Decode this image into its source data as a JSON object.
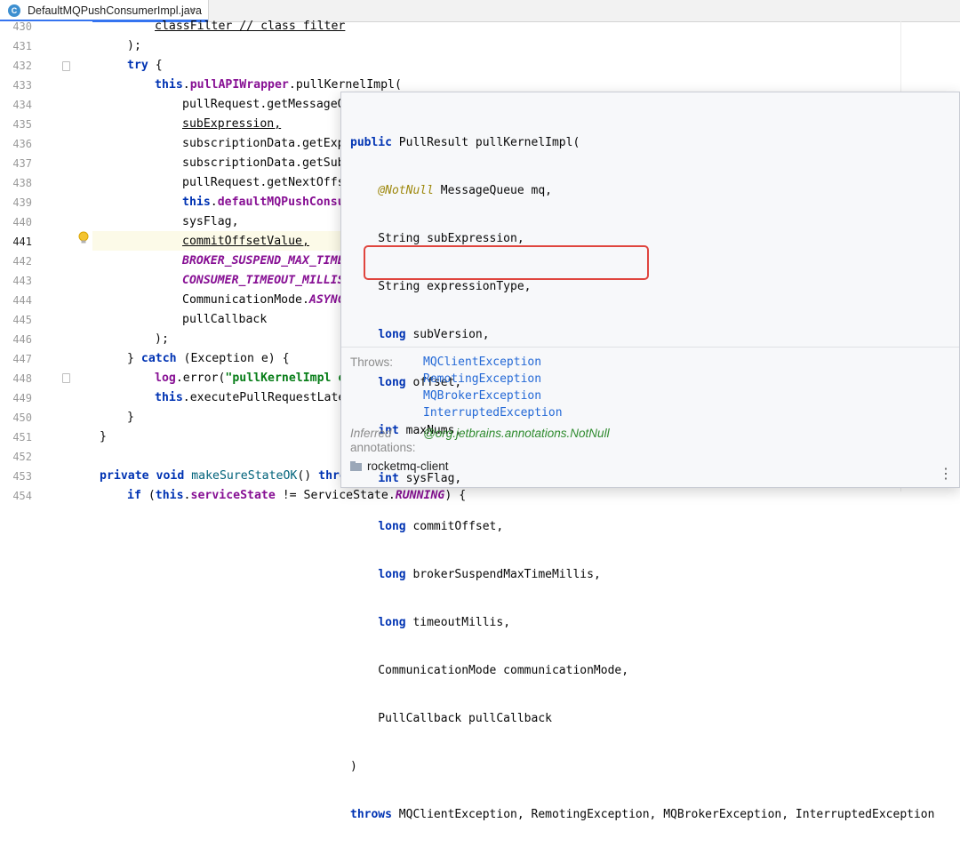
{
  "tab": {
    "label": "DefaultMQPushConsumerImpl.java",
    "icon_letter": "C",
    "icon": "class-icon",
    "close": "×"
  },
  "gutter": {
    "lines": [
      "430",
      "431",
      "432",
      "433",
      "434",
      "435",
      "436",
      "437",
      "438",
      "439",
      "440",
      "441",
      "442",
      "443",
      "444",
      "445",
      "446",
      "447",
      "448",
      "449",
      "450",
      "451",
      "452",
      "453",
      "454"
    ],
    "active_line": "441"
  },
  "code_lines": [
    "classFilter // class filter",
    ");",
    "try {",
    "this.pullAPIWrapper.pullKernelImpl(",
    "pullRequest.getMessageQ",
    "subExpression,",
    "subscriptionData.getExp",
    "subscriptionData.getSub",
    "pullRequest.getNextOffs",
    "this.defaultMQPushConsu",
    "sysFlag,",
    "commitOffsetValue,",
    "BROKER_SUSPEND_MAX_TIME",
    "CONSUMER_TIMEOUT_MILLIS",
    "CommunicationMode.ASYNC",
    "pullCallback",
    ");",
    "} catch (Exception e) {",
    "log.error(\"pullKernelImpl e",
    "this.executePullRequestLate",
    "}",
    "}",
    "",
    "private void makeSureStateOK() thro",
    "if (this.serviceState != ServiceState.RUNNING) {"
  ],
  "popup": {
    "signature": [
      "public PullResult pullKernelImpl(",
      "    @NotNull MessageQueue mq,",
      "    String subExpression,",
      "    String expressionType,",
      "    long subVersion,",
      "    long offset,",
      "    int maxNums,",
      "    int sysFlag,",
      "    long commitOffset,",
      "    long brokerSuspendMaxTimeMillis,",
      "    long timeoutMillis,",
      "    CommunicationMode communicationMode,",
      "    PullCallback pullCallback",
      ")",
      "throws MQClientException, RemotingException, MQBrokerException, InterruptedException"
    ],
    "throws_label": "Throws:",
    "throws": [
      "MQClientException",
      "RemotingException",
      "MQBrokerException",
      "InterruptedException"
    ],
    "inferred_label": "Inferred",
    "annotations_label": "annotations:",
    "inferred_value": "@org.jetbrains.annotations.NotNull",
    "module": "rocketmq-client",
    "more": "⋮"
  },
  "colors": {
    "keyword": "#0033b3",
    "field": "#871094",
    "string": "#067d17",
    "link": "#2469d6",
    "highlight_box": "#e0453e",
    "current_line": "#fcfae8"
  }
}
